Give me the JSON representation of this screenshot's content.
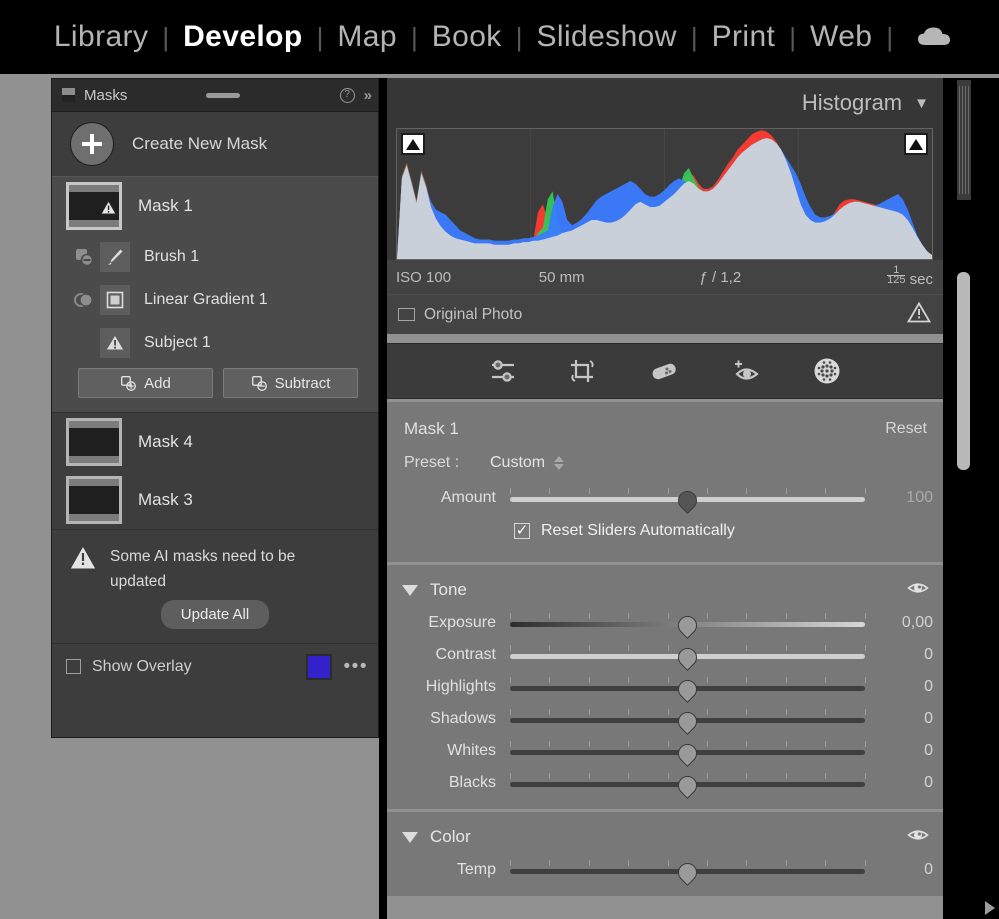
{
  "nav": {
    "items": [
      {
        "label": "Library",
        "active": false
      },
      {
        "label": "Develop",
        "active": true
      },
      {
        "label": "Map",
        "active": false
      },
      {
        "label": "Book",
        "active": false
      },
      {
        "label": "Slideshow",
        "active": false
      },
      {
        "label": "Print",
        "active": false
      },
      {
        "label": "Web",
        "active": false
      }
    ],
    "separator": "|",
    "cloud_icon": "cloud-icon"
  },
  "masks_panel": {
    "title": "Masks",
    "help_icon": "question-mark-icon",
    "collapse_icon": "double-chevron-right-icon",
    "grip_icon": "panel-grip-icon",
    "create_new_mask": "Create New Mask",
    "plus_icon": "plus-icon",
    "selected_mask": {
      "label": "Mask 1",
      "thumbnail_icon": "mask-thumbnail",
      "warning_icon": "warning-triangle-icon",
      "submasks": [
        {
          "label": "Brush 1",
          "op_icon": "subtract-op-icon",
          "kind_icon": "brush-icon"
        },
        {
          "label": "Linear Gradient 1",
          "op_icon": "add-op-icon",
          "kind_icon": "linear-gradient-icon"
        },
        {
          "label": "Subject 1",
          "op_icon": "",
          "kind_icon": "warning-triangle-icon"
        }
      ],
      "add_label": "Add",
      "subtract_label": "Subtract",
      "add_icon": "add-mask-icon",
      "subtract_icon": "subtract-mask-icon"
    },
    "other_masks": [
      {
        "label": "Mask 4",
        "thumbnail_icon": "mask-thumbnail"
      },
      {
        "label": "Mask 3",
        "thumbnail_icon": "mask-thumbnail"
      }
    ],
    "warning": {
      "icon": "warning-triangle-icon",
      "text": "Some AI masks need to be updated",
      "update_all_label": "Update All"
    },
    "footer": {
      "show_overlay_label": "Show Overlay",
      "checkbox_icon": "checkbox-unchecked-icon",
      "overlay_color": "#3322cc",
      "more_icon": "three-dots-icon"
    }
  },
  "histogram_panel": {
    "title": "Histogram",
    "caret_icon": "chevron-down-icon",
    "clip_left_icon": "shadow-clipping-triangle-icon",
    "clip_right_icon": "highlight-clipping-triangle-icon",
    "exif": {
      "iso": "ISO 100",
      "focal_length": "50 mm",
      "aperture": "ƒ / 1,2",
      "shutter_num": "1",
      "shutter_den": "125",
      "shutter_suffix": "sec"
    },
    "original_photo": {
      "label": "Original Photo",
      "rect_icon": "rectangle-icon",
      "warning_icon": "warning-triangle-icon"
    }
  },
  "chart_data": {
    "type": "area",
    "title": "Histogram",
    "xlabel": "",
    "ylabel": "",
    "grid": true,
    "legend": "none",
    "xlim": [
      0,
      255
    ],
    "ylim": [
      0,
      100
    ],
    "series": [
      {
        "name": "Luminance",
        "color": "#d7d7d7",
        "values": [
          0,
          62,
          72,
          58,
          43,
          66,
          55,
          40,
          31,
          25,
          21,
          18,
          16,
          15,
          14,
          13,
          12,
          12,
          12,
          12,
          11,
          11,
          11,
          11,
          12,
          12,
          13,
          13,
          14,
          14,
          15,
          16,
          17,
          18,
          20,
          21,
          22,
          24,
          26,
          28,
          30,
          30,
          29,
          28,
          28,
          29,
          31,
          34,
          38,
          42,
          44,
          42,
          40,
          40,
          41,
          44,
          47,
          50,
          54,
          58,
          60,
          58,
          54,
          52,
          52,
          54,
          58,
          63,
          68,
          73,
          78,
          82,
          85,
          88,
          90,
          92,
          93,
          92,
          89,
          84,
          76,
          66,
          54,
          42,
          34,
          30,
          28,
          28,
          29,
          31,
          34,
          38,
          41,
          43,
          44,
          44,
          43,
          42,
          41,
          40,
          39,
          38,
          37,
          36,
          34,
          30,
          24,
          17,
          11,
          6,
          3
        ]
      },
      {
        "name": "Red",
        "color": "#ff3b30",
        "values": [
          0,
          64,
          74,
          60,
          45,
          68,
          57,
          42,
          32,
          26,
          22,
          18,
          16,
          15,
          14,
          13,
          12,
          12,
          12,
          12,
          11,
          11,
          11,
          11,
          12,
          12,
          13,
          13,
          14,
          36,
          42,
          30,
          18,
          18,
          19,
          20,
          21,
          23,
          25,
          27,
          29,
          29,
          28,
          27,
          27,
          28,
          30,
          33,
          36,
          38,
          40,
          38,
          37,
          37,
          38,
          41,
          44,
          47,
          51,
          62,
          66,
          64,
          58,
          54,
          54,
          56,
          61,
          67,
          73,
          78,
          84,
          88,
          92,
          96,
          98,
          99,
          98,
          95,
          90,
          84,
          76,
          66,
          54,
          42,
          34,
          30,
          28,
          28,
          29,
          31,
          36,
          42,
          45,
          46,
          46,
          45,
          44,
          43,
          42,
          41,
          40,
          39,
          38,
          37,
          34,
          30,
          24,
          17,
          11,
          6,
          3
        ]
      },
      {
        "name": "Green",
        "color": "#34c759",
        "values": [
          0,
          63,
          73,
          59,
          44,
          67,
          56,
          41,
          31,
          25,
          21,
          18,
          16,
          15,
          14,
          13,
          12,
          12,
          12,
          12,
          11,
          11,
          11,
          11,
          12,
          12,
          13,
          13,
          14,
          20,
          24,
          46,
          52,
          30,
          20,
          21,
          22,
          24,
          26,
          28,
          30,
          30,
          29,
          28,
          28,
          29,
          31,
          34,
          38,
          42,
          44,
          42,
          40,
          40,
          41,
          44,
          47,
          50,
          54,
          66,
          70,
          62,
          55,
          52,
          52,
          54,
          58,
          63,
          68,
          73,
          78,
          82,
          85,
          88,
          90,
          92,
          93,
          92,
          89,
          84,
          76,
          66,
          54,
          42,
          34,
          30,
          28,
          28,
          29,
          31,
          34,
          38,
          41,
          43,
          44,
          44,
          43,
          42,
          41,
          40,
          39,
          38,
          37,
          36,
          34,
          30,
          24,
          17,
          11,
          6,
          3
        ]
      },
      {
        "name": "Blue",
        "color": "#3a7bff",
        "values": [
          0,
          62,
          72,
          58,
          43,
          66,
          55,
          44,
          38,
          36,
          34,
          30,
          26,
          22,
          20,
          18,
          16,
          15,
          15,
          15,
          14,
          14,
          14,
          14,
          15,
          15,
          16,
          16,
          17,
          18,
          20,
          22,
          40,
          50,
          44,
          30,
          26,
          28,
          31,
          35,
          40,
          45,
          48,
          50,
          52,
          54,
          56,
          58,
          60,
          58,
          54,
          50,
          48,
          48,
          50,
          53,
          57,
          60,
          62,
          60,
          58,
          56,
          54,
          52,
          52,
          54,
          58,
          63,
          68,
          73,
          78,
          82,
          85,
          88,
          90,
          92,
          93,
          92,
          89,
          84,
          78,
          72,
          66,
          58,
          48,
          40,
          34,
          32,
          32,
          33,
          35,
          38,
          41,
          43,
          44,
          44,
          43,
          42,
          41,
          42,
          44,
          46,
          48,
          50,
          46,
          38,
          28,
          18,
          11,
          6,
          3
        ]
      }
    ]
  },
  "toolstrip": {
    "tools": [
      {
        "name": "basic-edit-icon",
        "active": false
      },
      {
        "name": "crop-icon",
        "active": false
      },
      {
        "name": "healing-brush-icon",
        "active": false
      },
      {
        "name": "red-eye-icon",
        "active": false
      },
      {
        "name": "masking-icon",
        "active": true
      }
    ]
  },
  "mask_settings": {
    "title": "Mask 1",
    "reset_label": "Reset",
    "preset_label": "Preset :",
    "preset_value": "Custom",
    "stepper_icon": "stepper-arrows-icon",
    "amount": {
      "label": "Amount",
      "value": "100",
      "position": 50
    },
    "reset_sliders": {
      "label": "Reset Sliders Automatically",
      "checked": true,
      "icon": "checkbox-checked-icon"
    }
  },
  "tone_section": {
    "title": "Tone",
    "caret_icon": "triangle-down-icon",
    "eye_icon": "eye-icon",
    "sliders": [
      {
        "label": "Exposure",
        "value": "0,00",
        "position": 50,
        "track": "grad"
      },
      {
        "label": "Contrast",
        "value": "0",
        "position": 50,
        "track": "light"
      },
      {
        "label": "Highlights",
        "value": "0",
        "position": 50,
        "track": "dark"
      },
      {
        "label": "Shadows",
        "value": "0",
        "position": 50,
        "track": "dark"
      },
      {
        "label": "Whites",
        "value": "0",
        "position": 50,
        "track": "dark"
      },
      {
        "label": "Blacks",
        "value": "0",
        "position": 50,
        "track": "dark"
      }
    ]
  },
  "color_section": {
    "title": "Color",
    "caret_icon": "triangle-down-icon",
    "eye_icon": "eye-icon",
    "sliders": [
      {
        "label": "Temp",
        "value": "0",
        "position": 50,
        "track": "dark"
      }
    ]
  },
  "scrollbar": {
    "vertical_thumb": "vertical-scrollbar-thumb",
    "corner_arrow": "right-arrow-icon"
  }
}
